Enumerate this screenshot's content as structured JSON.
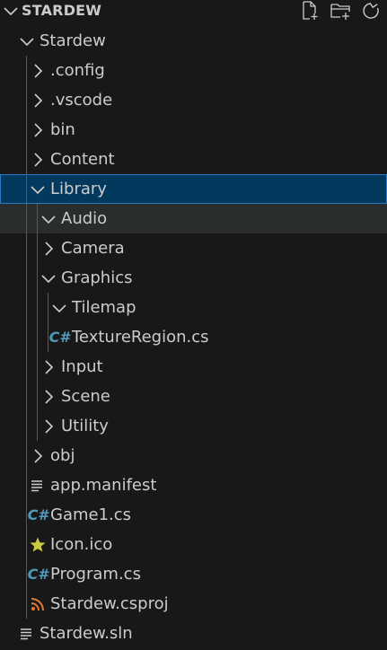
{
  "explorer": {
    "section_title": "STARDEW",
    "actions": [
      "new-file-icon",
      "new-folder-icon",
      "refresh-icon"
    ]
  },
  "tree": [
    {
      "label": "Stardew",
      "kind": "folder-open",
      "depth": 0
    },
    {
      "label": ".config",
      "kind": "folder",
      "depth": 1
    },
    {
      "label": ".vscode",
      "kind": "folder",
      "depth": 1
    },
    {
      "label": "bin",
      "kind": "folder",
      "depth": 1
    },
    {
      "label": "Content",
      "kind": "folder",
      "depth": 1
    },
    {
      "label": "Library",
      "kind": "folder-open",
      "depth": 1,
      "selected": true
    },
    {
      "label": "Audio",
      "kind": "folder-open",
      "depth": 2,
      "hover": true
    },
    {
      "label": "Camera",
      "kind": "folder",
      "depth": 2
    },
    {
      "label": "Graphics",
      "kind": "folder-open",
      "depth": 2
    },
    {
      "label": "Tilemap",
      "kind": "folder-open",
      "depth": 3
    },
    {
      "label": "TextureRegion.cs",
      "kind": "cs",
      "depth": 3
    },
    {
      "label": "Input",
      "kind": "folder",
      "depth": 2
    },
    {
      "label": "Scene",
      "kind": "folder",
      "depth": 2
    },
    {
      "label": "Utility",
      "kind": "folder",
      "depth": 2
    },
    {
      "label": "obj",
      "kind": "folder",
      "depth": 1
    },
    {
      "label": "app.manifest",
      "kind": "lines",
      "depth": 1
    },
    {
      "label": "Game1.cs",
      "kind": "cs",
      "depth": 1
    },
    {
      "label": "Icon.ico",
      "kind": "star",
      "depth": 1
    },
    {
      "label": "Program.cs",
      "kind": "cs",
      "depth": 1
    },
    {
      "label": "Stardew.csproj",
      "kind": "rss",
      "depth": 1
    },
    {
      "label": "Stardew.sln",
      "kind": "lines",
      "depth": 0
    }
  ],
  "colors": {
    "background": "#181818",
    "text": "#cccccc",
    "selected_bg": "#04395e",
    "selected_border": "#2b79c2",
    "hover_bg": "#2a2d2e",
    "cs_icon": "#519aba",
    "star_icon": "#cbcb41",
    "rss_icon": "#e37933"
  }
}
